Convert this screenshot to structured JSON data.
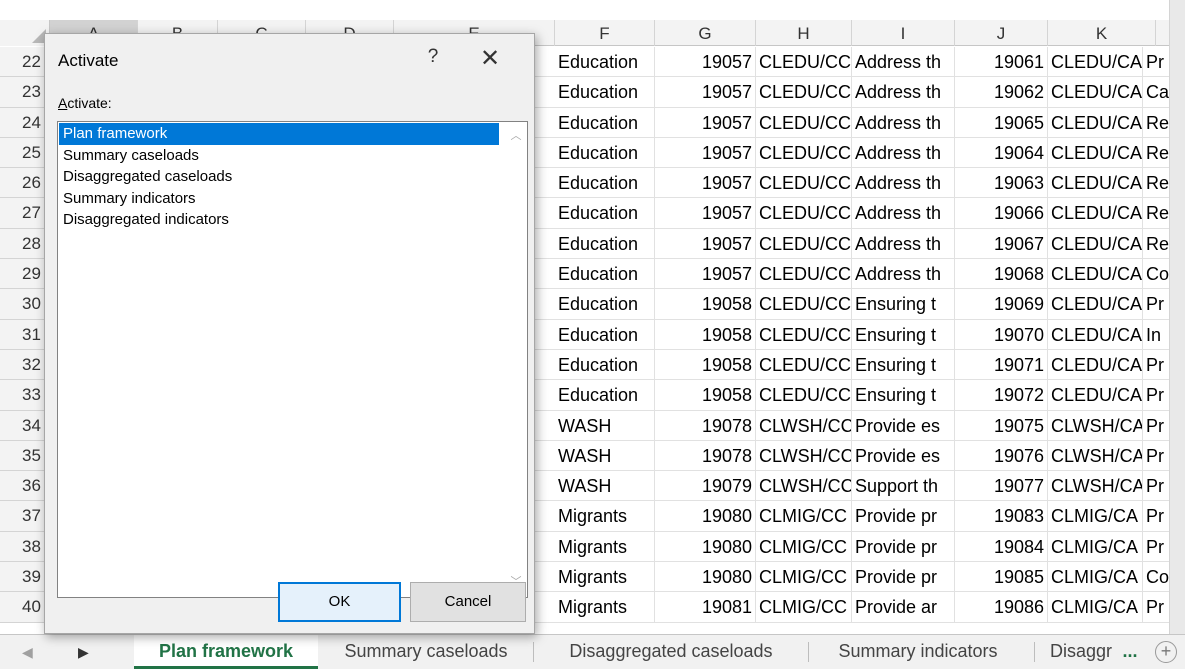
{
  "columns": [
    "A",
    "B",
    "C",
    "D",
    "E",
    "F",
    "G",
    "H",
    "I",
    "J",
    "K"
  ],
  "rows": [
    {
      "n": "22",
      "f": "Education",
      "g": "19057",
      "h": "CLEDU/CC",
      "i": "Address th",
      "j": "19061",
      "k": "CLEDU/CA",
      "l": "Pr"
    },
    {
      "n": "23",
      "f": "Education",
      "g": "19057",
      "h": "CLEDU/CC",
      "i": "Address th",
      "j": "19062",
      "k": "CLEDU/CA",
      "l": "Ca"
    },
    {
      "n": "24",
      "f": "Education",
      "g": "19057",
      "h": "CLEDU/CC",
      "i": "Address th",
      "j": "19065",
      "k": "CLEDU/CA",
      "l": "Re"
    },
    {
      "n": "25",
      "f": "Education",
      "g": "19057",
      "h": "CLEDU/CC",
      "i": "Address th",
      "j": "19064",
      "k": "CLEDU/CA",
      "l": "Re"
    },
    {
      "n": "26",
      "f": "Education",
      "g": "19057",
      "h": "CLEDU/CC",
      "i": "Address th",
      "j": "19063",
      "k": "CLEDU/CA",
      "l": "Re"
    },
    {
      "n": "27",
      "f": "Education",
      "g": "19057",
      "h": "CLEDU/CC",
      "i": "Address th",
      "j": "19066",
      "k": "CLEDU/CA",
      "l": "Re"
    },
    {
      "n": "28",
      "f": "Education",
      "g": "19057",
      "h": "CLEDU/CC",
      "i": "Address th",
      "j": "19067",
      "k": "CLEDU/CA",
      "l": "Re"
    },
    {
      "n": "29",
      "f": "Education",
      "g": "19057",
      "h": "CLEDU/CC",
      "i": "Address th",
      "j": "19068",
      "k": "CLEDU/CA",
      "l": "Co"
    },
    {
      "n": "30",
      "f": "Education",
      "g": "19058",
      "h": "CLEDU/CC",
      "i": "Ensuring t",
      "j": "19069",
      "k": "CLEDU/CA",
      "l": "Pr"
    },
    {
      "n": "31",
      "f": "Education",
      "g": "19058",
      "h": "CLEDU/CC",
      "i": "Ensuring t",
      "j": "19070",
      "k": "CLEDU/CA",
      "l": "In"
    },
    {
      "n": "32",
      "f": "Education",
      "g": "19058",
      "h": "CLEDU/CC",
      "i": "Ensuring t",
      "j": "19071",
      "k": "CLEDU/CA",
      "l": "Pr"
    },
    {
      "n": "33",
      "f": "Education",
      "g": "19058",
      "h": "CLEDU/CC",
      "i": "Ensuring t",
      "j": "19072",
      "k": "CLEDU/CA",
      "l": "Pr"
    },
    {
      "n": "34",
      "f": "WASH",
      "g": "19078",
      "h": "CLWSH/CC",
      "i": "Provide es",
      "j": "19075",
      "k": "CLWSH/CA",
      "l": "Pr"
    },
    {
      "n": "35",
      "f": "WASH",
      "g": "19078",
      "h": "CLWSH/CC",
      "i": "Provide es",
      "j": "19076",
      "k": "CLWSH/CA",
      "l": "Pr"
    },
    {
      "n": "36",
      "f": "WASH",
      "g": "19079",
      "h": "CLWSH/CC",
      "i": "Support th",
      "j": "19077",
      "k": "CLWSH/CA",
      "l": "Pr"
    },
    {
      "n": "37",
      "f": "Migrants",
      "g": "19080",
      "h": "CLMIG/CC",
      "i": "Provide pr",
      "j": "19083",
      "k": "CLMIG/CA",
      "l": "Pr"
    },
    {
      "n": "38",
      "f": "Migrants",
      "g": "19080",
      "h": "CLMIG/CC",
      "i": "Provide pr",
      "j": "19084",
      "k": "CLMIG/CA",
      "l": "Pr"
    },
    {
      "n": "39",
      "f": "Migrants",
      "g": "19080",
      "h": "CLMIG/CC",
      "i": "Provide pr",
      "j": "19085",
      "k": "CLMIG/CA",
      "l": "Co"
    },
    {
      "n": "40",
      "f": "Migrants",
      "g": "19081",
      "h": "CLMIG/CC",
      "i": "Provide ar",
      "j": "19086",
      "k": "CLMIG/CA",
      "l": "Pr"
    }
  ],
  "dialog": {
    "title": "Activate",
    "help": "?",
    "close": "✕",
    "label": "Activate:",
    "items": [
      "Plan framework",
      "Summary caseloads",
      "Disaggregated caseloads",
      "Summary indicators",
      "Disaggregated indicators"
    ],
    "selected_index": 0,
    "ok": "OK",
    "cancel": "Cancel"
  },
  "tabs": {
    "nav_prev": "◀",
    "nav_next": "▶",
    "items": [
      "Plan framework",
      "Summary caseloads",
      "Disaggregated caseloads",
      "Summary indicators",
      "Disaggr"
    ],
    "more": "...",
    "add": "+",
    "accent": "#217346"
  },
  "colors": {
    "selection": "#0078d7",
    "excel_green": "#217346"
  }
}
